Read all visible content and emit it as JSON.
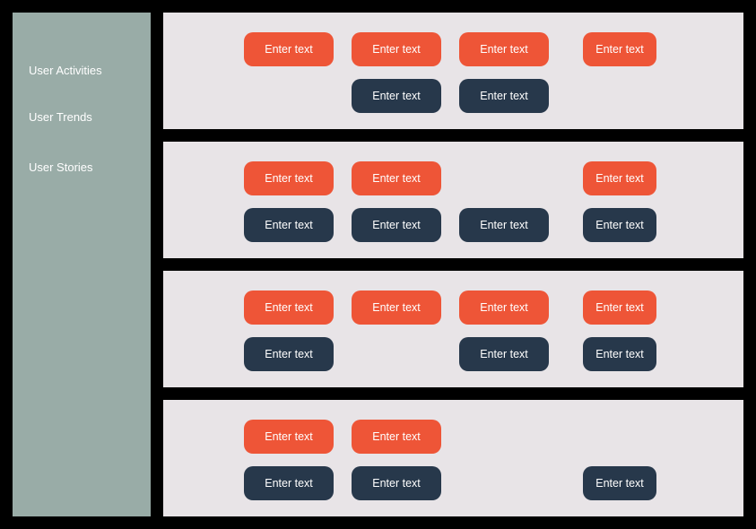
{
  "sidebar": {
    "activities": "User Activities",
    "trends": "User Trends",
    "stories": "User Stories"
  },
  "placeholder": "Enter text",
  "panels": [
    {
      "rows": [
        [
          "red",
          "red",
          "red",
          "red"
        ],
        [
          null,
          "navy",
          "navy",
          null
        ]
      ]
    },
    {
      "rows": [
        [
          "red",
          "red",
          null,
          "red"
        ],
        [
          "navy",
          "navy",
          "navy",
          "navy"
        ]
      ]
    },
    {
      "rows": [
        [
          "red",
          "red",
          "red",
          "red"
        ],
        [
          "navy",
          null,
          "navy",
          "navy"
        ]
      ]
    },
    {
      "rows": [
        [
          "red",
          "red",
          null,
          null
        ],
        [
          "navy",
          "navy",
          null,
          "navy"
        ]
      ]
    }
  ]
}
